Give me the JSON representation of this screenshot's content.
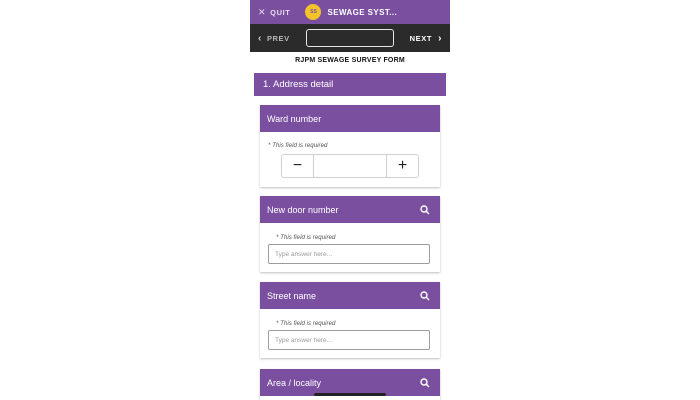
{
  "topbar": {
    "quit_label": "QUIT",
    "avatar_text": "SS",
    "app_title": "SEWAGE SYST..."
  },
  "navbar": {
    "prev_label": "PREV",
    "next_label": "NEXT"
  },
  "form": {
    "title": "RJPM SEWAGE SURVEY FORM",
    "section_title": "1. Address detail"
  },
  "fields": [
    {
      "label": "Ward number",
      "required_text": "* This field is required",
      "type": "stepper",
      "value": ""
    },
    {
      "label": "New door number",
      "required_text": "* This field is required",
      "type": "text",
      "placeholder": "Type answer here..."
    },
    {
      "label": "Street name",
      "required_text": "* This field is required",
      "type": "text",
      "placeholder": "Type answer here..."
    },
    {
      "label": "Area / locality"
    }
  ],
  "icons": {
    "quit": "close-icon",
    "prev": "chevron-left-icon",
    "next": "chevron-right-icon",
    "search": "search-icon",
    "minus": "minus-icon",
    "plus": "plus-icon"
  },
  "colors": {
    "brand_purple": "#7b4fa0",
    "nav_dark": "#2b2b2b",
    "avatar_yellow": "#f4c22b"
  }
}
